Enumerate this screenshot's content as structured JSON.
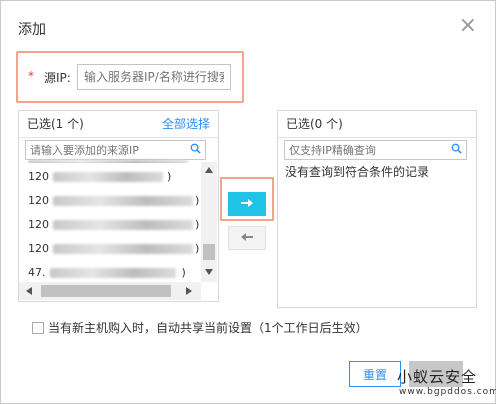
{
  "dialog": {
    "title": "添加",
    "close_glyph": "×"
  },
  "source": {
    "required_mark": "*",
    "label": "源IP:",
    "placeholder": "输入服务器IP/名称进行搜索"
  },
  "left_panel": {
    "header": "已选(1 个)",
    "select_all": "全部选择",
    "search_placeholder": "请输入要添加的来源IP",
    "rows": [
      {
        "prefix": "120",
        "suffix": ")"
      },
      {
        "prefix": "120",
        "suffix": ")"
      },
      {
        "prefix": "120",
        "suffix": ")"
      },
      {
        "prefix": "120",
        "suffix": ")"
      },
      {
        "prefix": "47.",
        "suffix": ")"
      }
    ]
  },
  "right_panel": {
    "header": "已选(0 个)",
    "search_placeholder": "仅支持IP精确查询",
    "empty": "没有查询到符合条件的记录"
  },
  "share_option": {
    "text": "当有新主机购入时，自动共享当前设置（1个工作日后生效）"
  },
  "footer": {
    "reset_label": "重置"
  },
  "watermark": {
    "line1": "小蚁云安全",
    "line2": "www.bgpddos.com"
  },
  "colors": {
    "accent": "#2a8ff7",
    "arrow_button": "#1ec3e6",
    "highlight_border": "#f0a58c",
    "required": "#e0432e"
  }
}
